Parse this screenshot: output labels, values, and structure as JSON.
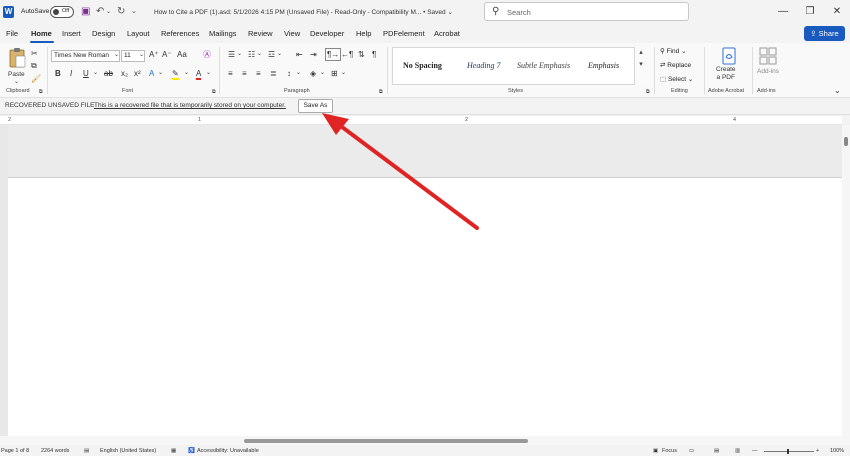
{
  "titlebar": {
    "app_letter": "W",
    "autosave_label": "AutoSave",
    "autosave_state": "Off",
    "title": "How to Cite a PDF (1).asd: 5/1/2026 4:15 PM (Unsaved File)  -  Read-Only  -  Compatibility M...  •  Saved ⌄",
    "search_placeholder": "Search",
    "minimize_icon": "—",
    "restore_icon": "❐",
    "close_icon": "✕"
  },
  "tabs": [
    "File",
    "Home",
    "Insert",
    "Design",
    "Layout",
    "References",
    "Mailings",
    "Review",
    "View",
    "Developer",
    "Help",
    "PDFelement",
    "Acrobat"
  ],
  "share_label": "Share",
  "ribbon": {
    "clipboard": {
      "paste_label": "Paste",
      "group_label": "Clipboard"
    },
    "font": {
      "font_name": "Times New Roman",
      "font_size": "11",
      "group_label": "Font"
    },
    "paragraph": {
      "group_label": "Paragraph"
    },
    "styles": {
      "items": [
        "No Spacing",
        "Heading 7",
        "Subtle Emphasis",
        "Emphasis"
      ],
      "group_label": "Styles"
    },
    "editing": {
      "find": "Find",
      "replace": "Replace",
      "select": "Select",
      "group_label": "Editing"
    },
    "acrobat": {
      "create_label_1": "Create",
      "create_label_2": "a PDF",
      "group_label": "Adobe Acrobat"
    },
    "addins": {
      "label": "Add-ins",
      "group_label": "Add-ins"
    }
  },
  "recovered": {
    "title": "RECOVERED UNSAVED FILE",
    "message": "This is a recovered file that is temporarily stored on your computer.",
    "button": "Save As"
  },
  "ruler": {
    "marks": [
      "2",
      "1",
      "2",
      "4"
    ]
  },
  "status": {
    "page": "Page 1 of 8",
    "words": "2264 words",
    "language": "English (United States)",
    "accessibility": "Accessibility: Unavailable",
    "focus": "Focus",
    "zoom": "100%"
  },
  "colors": {
    "accent": "#185abd",
    "annotation_arrow": "#e02424"
  }
}
